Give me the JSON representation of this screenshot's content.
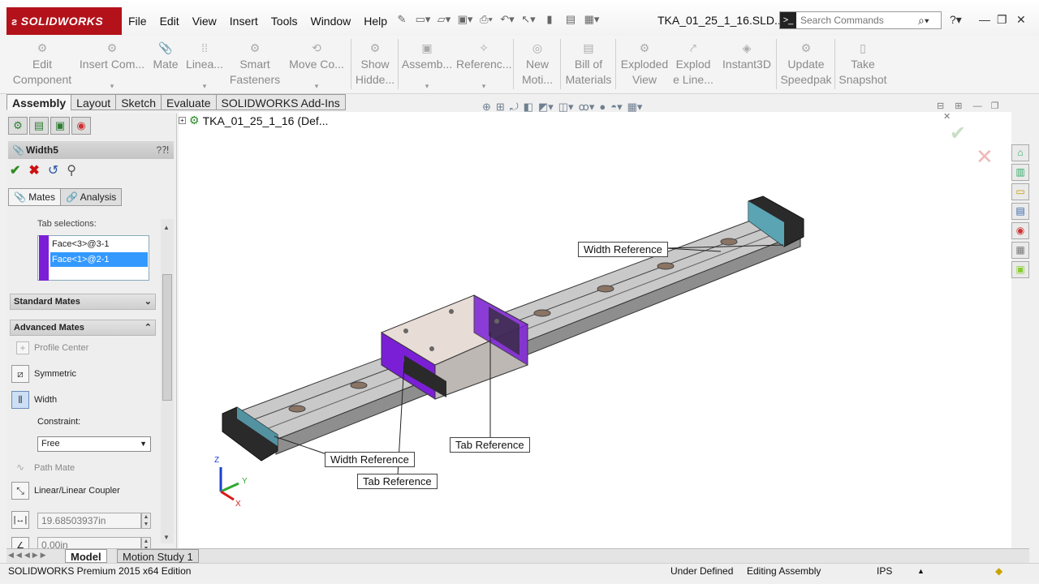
{
  "app": {
    "logo": "SOLIDWORKS",
    "doc_title": "TKA_01_25_1_16.SLD..."
  },
  "menu": [
    "File",
    "Edit",
    "View",
    "Insert",
    "Tools",
    "Window",
    "Help"
  ],
  "search": {
    "placeholder": "Search Commands"
  },
  "commands": [
    {
      "label1": "Edit",
      "label2": "Component"
    },
    {
      "label1": "Insert Com...",
      "label2": ""
    },
    {
      "label1": "Mate",
      "label2": ""
    },
    {
      "label1": "Linea...",
      "label2": ""
    },
    {
      "label1": "Smart",
      "label2": "Fasteners"
    },
    {
      "label1": "Move Co...",
      "label2": ""
    },
    {
      "label1": "Show",
      "label2": "Hidde..."
    },
    {
      "label1": "Assemb...",
      "label2": ""
    },
    {
      "label1": "Referenc...",
      "label2": ""
    },
    {
      "label1": "New",
      "label2": "Moti..."
    },
    {
      "label1": "Bill of",
      "label2": "Materials"
    },
    {
      "label1": "Exploded",
      "label2": "View"
    },
    {
      "label1": "Explod",
      "label2": "e Line..."
    },
    {
      "label1": "Instant3D",
      "label2": ""
    },
    {
      "label1": "Update",
      "label2": "Speedpak"
    },
    {
      "label1": "Take",
      "label2": "Snapshot"
    }
  ],
  "tabs": [
    "Assembly",
    "Layout",
    "Sketch",
    "Evaluate",
    "SOLIDWORKS Add-Ins"
  ],
  "property_manager": {
    "title": "Width5",
    "subtabs": [
      "Mates",
      "Analysis"
    ],
    "group_note": "Tab selections:",
    "selections": [
      "Face<3>@3-1",
      "Face<1>@2-1"
    ],
    "standard_mates": "Standard Mates",
    "advanced_mates": "Advanced Mates",
    "options": {
      "profile_center": "Profile Center",
      "symmetric": "Symmetric",
      "width": "Width",
      "constraint_label": "Constraint:",
      "constraint_value": "Free",
      "path_mate": "Path Mate",
      "linear_coupler": "Linear/Linear Coupler",
      "distance_value": "19.68503937in",
      "second_value": "0.00in"
    }
  },
  "graphics": {
    "tree_root": "TKA_01_25_1_16  (Def...",
    "callouts": {
      "width_ref_top": "Width Reference",
      "width_ref_bottom": "Width Reference",
      "tab_ref_right": "Tab Reference",
      "tab_ref_bottom": "Tab Reference"
    },
    "triad": {
      "x": "X",
      "y": "Y",
      "z": "Z"
    }
  },
  "bottom_tabs": [
    "Model",
    "Motion Study 1"
  ],
  "status": {
    "edition": "SOLIDWORKS Premium 2015 x64 Edition",
    "definition": "Under Defined",
    "mode": "Editing Assembly",
    "units": "IPS"
  },
  "colors": {
    "accent": "#7b1fd6",
    "brand": "#b3121a",
    "selection": "#3399ff",
    "face_highlight": "#6fd8f0"
  }
}
